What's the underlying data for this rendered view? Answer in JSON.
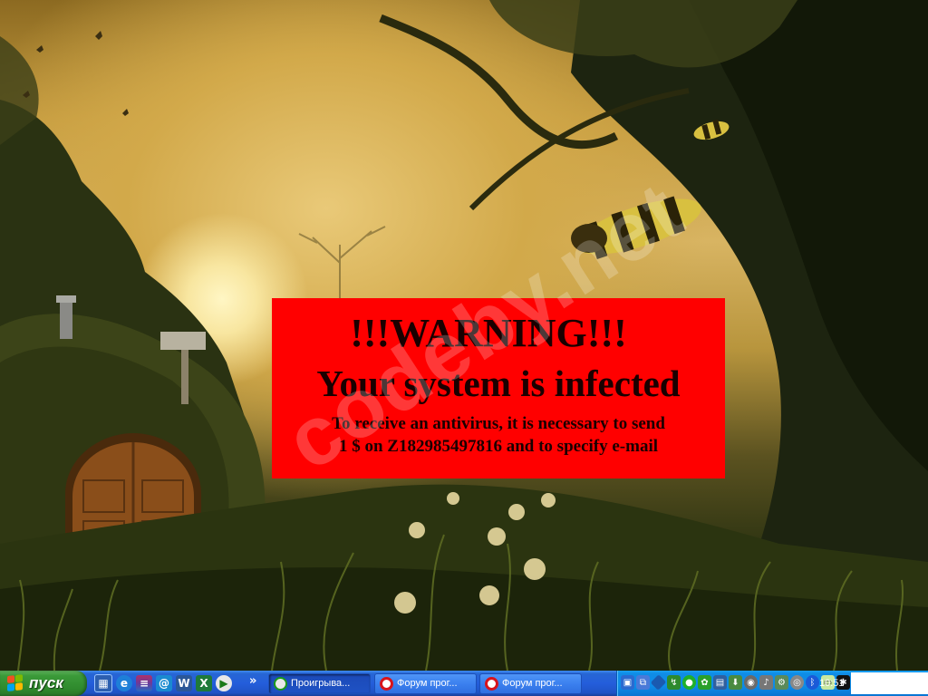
{
  "warning": {
    "title": "!!!WARNING!!!",
    "subtitle": "Your system is infected",
    "line1": "To receive an antivirus, it is necessary to send",
    "line2": "1 $ on Z182985497816 and to specify e-mail",
    "background_color": "#ff0000"
  },
  "watermark": "codeby.net",
  "taskbar": {
    "start_label": "пуск",
    "quick_launch": [
      "show-desktop-icon",
      "internet-explorer-icon",
      "winrar-icon",
      "outlook-express-icon",
      "word-icon",
      "excel-icon",
      "media-player-icon"
    ],
    "overflow": "»",
    "tasks": [
      {
        "label": "Проигрыва...",
        "icon": "media-player-icon",
        "active": true
      },
      {
        "label": "Форум прог...",
        "icon": "opera-icon",
        "active": false
      },
      {
        "label": "Форум прог...",
        "icon": "opera-icon",
        "active": false
      }
    ],
    "clock": "10:51"
  }
}
